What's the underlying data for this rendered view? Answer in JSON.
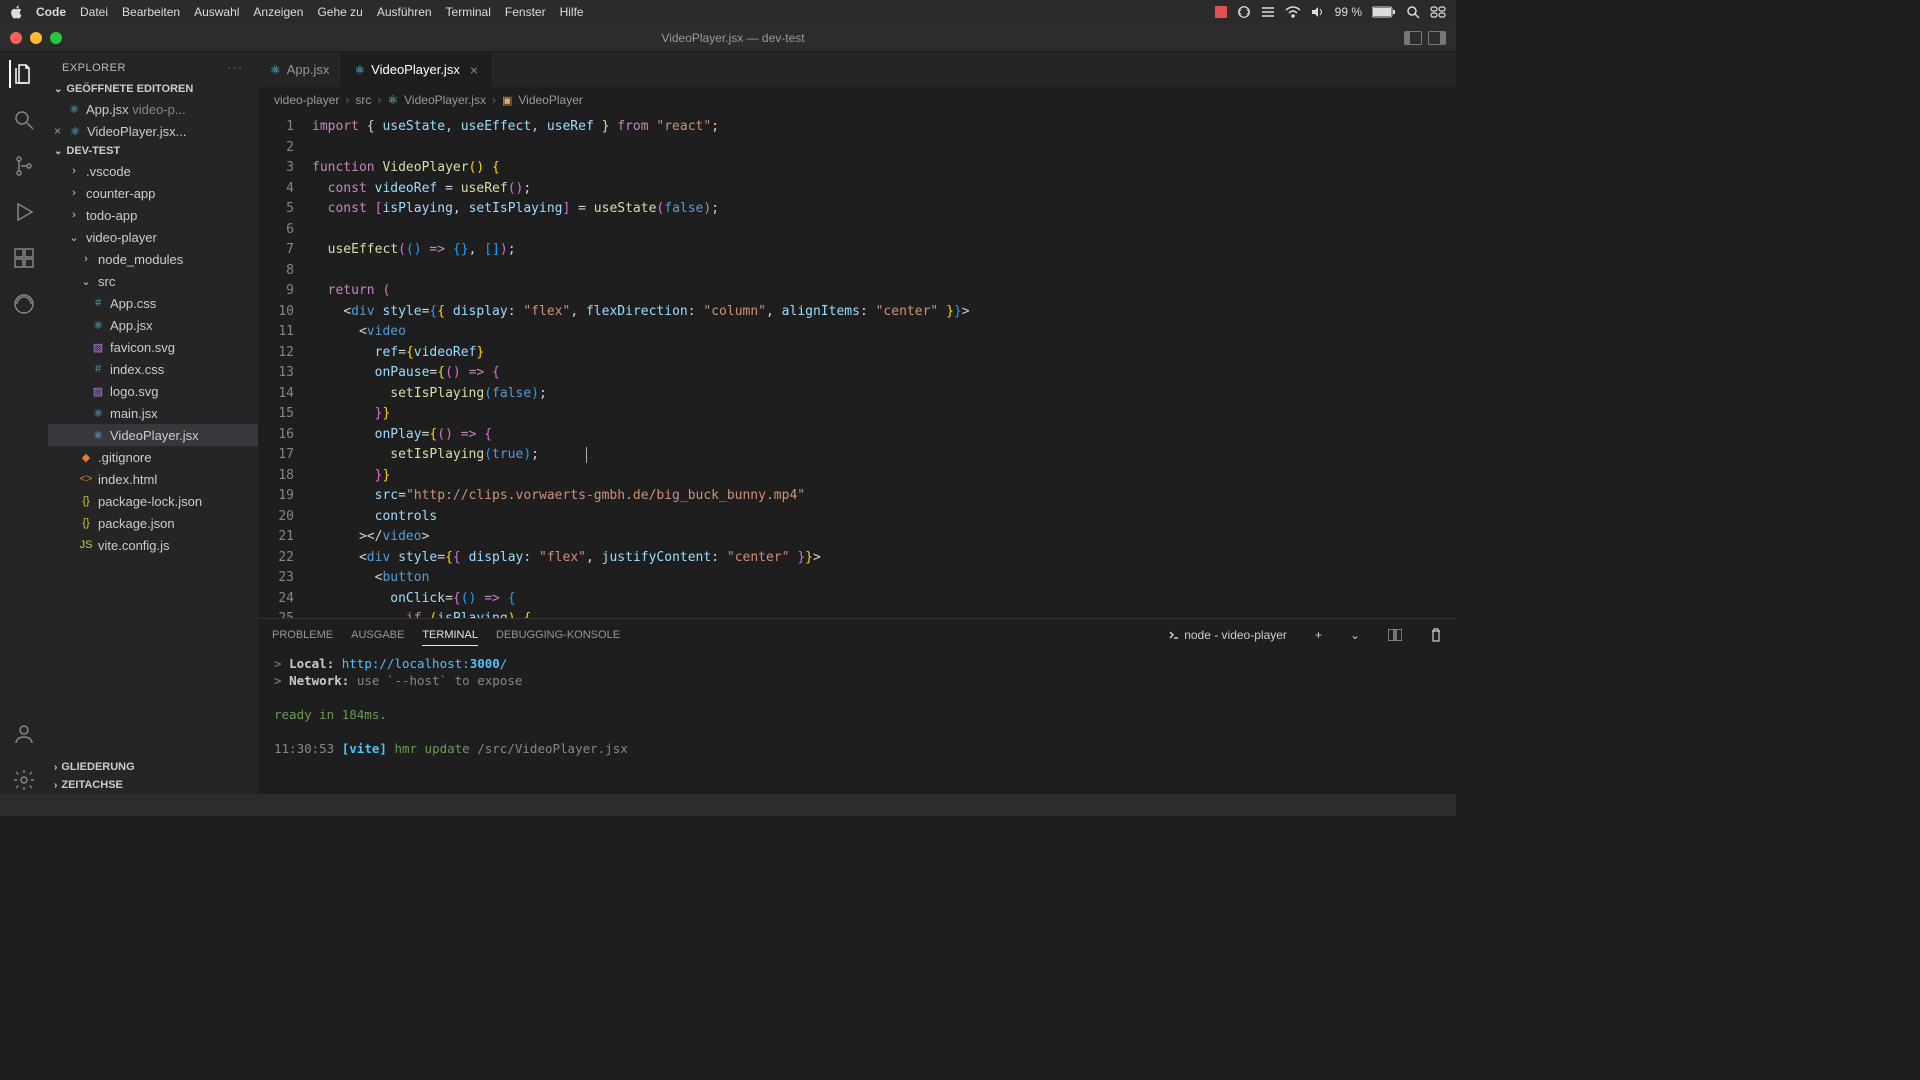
{
  "menubar": {
    "app": "Code",
    "items": [
      "Datei",
      "Bearbeiten",
      "Auswahl",
      "Anzeigen",
      "Gehe zu",
      "Ausführen",
      "Terminal",
      "Fenster",
      "Hilfe"
    ],
    "battery": "99 %"
  },
  "titlebar": {
    "title": "VideoPlayer.jsx — dev-test"
  },
  "sidebar": {
    "title": "EXPLORER",
    "openEditors": {
      "label": "GEÖFFNETE EDITOREN",
      "items": [
        {
          "name": "App.jsx",
          "hint": "video-p..."
        },
        {
          "name": "VideoPlayer.jsx...",
          "active": true
        }
      ]
    },
    "workspace": {
      "label": "DEV-TEST",
      "tree": [
        {
          "name": ".vscode",
          "type": "folder",
          "depth": 1
        },
        {
          "name": "counter-app",
          "type": "folder",
          "depth": 1
        },
        {
          "name": "todo-app",
          "type": "folder",
          "depth": 1
        },
        {
          "name": "video-player",
          "type": "folder",
          "depth": 1,
          "open": true
        },
        {
          "name": "node_modules",
          "type": "folder",
          "depth": 2
        },
        {
          "name": "src",
          "type": "folder",
          "depth": 2,
          "open": true
        },
        {
          "name": "App.css",
          "type": "css",
          "depth": 3
        },
        {
          "name": "App.jsx",
          "type": "react",
          "depth": 3
        },
        {
          "name": "favicon.svg",
          "type": "svg",
          "depth": 3
        },
        {
          "name": "index.css",
          "type": "css",
          "depth": 3
        },
        {
          "name": "logo.svg",
          "type": "svg",
          "depth": 3
        },
        {
          "name": "main.jsx",
          "type": "react",
          "depth": 3
        },
        {
          "name": "VideoPlayer.jsx",
          "type": "react",
          "depth": 3,
          "selected": true
        },
        {
          "name": ".gitignore",
          "type": "git",
          "depth": 2
        },
        {
          "name": "index.html",
          "type": "html",
          "depth": 2
        },
        {
          "name": "package-lock.json",
          "type": "json",
          "depth": 2
        },
        {
          "name": "package.json",
          "type": "json",
          "depth": 2
        },
        {
          "name": "vite.config.js",
          "type": "js",
          "depth": 2
        }
      ]
    },
    "outline": "GLIEDERUNG",
    "timeline": "ZEITACHSE"
  },
  "tabs": [
    {
      "name": "App.jsx",
      "active": false
    },
    {
      "name": "VideoPlayer.jsx",
      "active": true
    }
  ],
  "breadcrumb": [
    "video-player",
    "src",
    "VideoPlayer.jsx",
    "VideoPlayer"
  ],
  "code": {
    "lines": 25,
    "l1_import": "import",
    "l1_hooks": "useState, useEffect, useRef",
    "l1_from": "from",
    "l1_react": "\"react\"",
    "l3_fn": "function",
    "l3_name": "VideoPlayer",
    "l4_const": "const",
    "l4_ref": "videoRef",
    "l4_useRef": "useRef",
    "l5_isPlaying": "isPlaying",
    "l5_setIsPlaying": "setIsPlaying",
    "l5_useState": "useState",
    "l5_false": "false",
    "l7_useEffect": "useEffect",
    "l9_return": "return",
    "l10_div": "div",
    "l10_style": "style",
    "l10_display": "display",
    "l10_flex": "\"flex\"",
    "l10_fd": "flexDirection",
    "l10_col": "\"column\"",
    "l10_ai": "alignItems",
    "l10_center": "\"center\"",
    "l11_video": "video",
    "l12_ref": "ref",
    "l12_videoRef": "videoRef",
    "l13_onPause": "onPause",
    "l14_setIsPlaying": "setIsPlaying",
    "l14_false": "false",
    "l16_onPlay": "onPlay",
    "l17_true": "true",
    "l19_src": "src",
    "l19_url": "\"http://clips.vorwaerts-gmbh.de/big_buck_bunny.mp4\"",
    "l20_controls": "controls",
    "l21_video": "video",
    "l22_jc": "justifyContent",
    "l23_button": "button",
    "l24_onClick": "onClick",
    "l25_if": "if"
  },
  "panel": {
    "tabs": [
      "PROBLEME",
      "AUSGABE",
      "TERMINAL",
      "DEBUGGING-KONSOLE"
    ],
    "process": "node - video-player",
    "terminal": {
      "local_label": "Local:",
      "local_url_a": "http://localhost:",
      "local_url_b": "3000",
      "local_url_c": "/",
      "network_label": "Network:",
      "network_hint": "use `--host` to expose",
      "ready": "ready in 184ms.",
      "hmr_time": "11:30:53",
      "hmr_tag": "[vite]",
      "hmr_msg": "hmr update",
      "hmr_path": "/src/VideoPlayer.jsx"
    }
  }
}
